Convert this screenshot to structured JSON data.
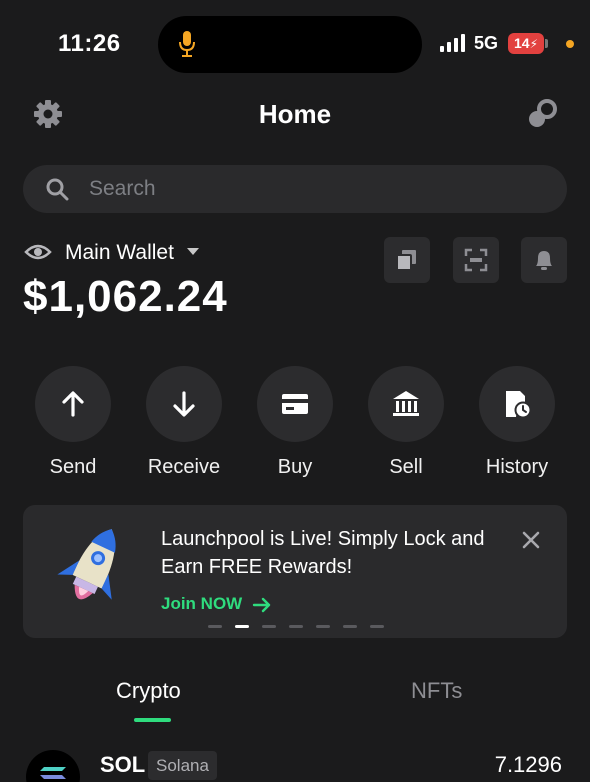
{
  "status_bar": {
    "time": "11:26",
    "network": "5G",
    "battery": "14"
  },
  "header": {
    "title": "Home",
    "left_icon": "gear-icon",
    "right_icon": "link-icon"
  },
  "search": {
    "placeholder": "Search"
  },
  "wallet": {
    "name": "Main Wallet",
    "balance": "$1,062.24",
    "quick_buttons": [
      "copy-icon",
      "scan-icon",
      "bell-icon"
    ]
  },
  "actions": [
    {
      "label": "Send",
      "icon": "arrow-up-icon"
    },
    {
      "label": "Receive",
      "icon": "arrow-down-icon"
    },
    {
      "label": "Buy",
      "icon": "card-icon"
    },
    {
      "label": "Sell",
      "icon": "bank-icon"
    },
    {
      "label": "History",
      "icon": "history-icon"
    }
  ],
  "banner": {
    "text": "Launchpool is Live! Simply Lock and Earn FREE Rewards!",
    "cta": "Join NOW",
    "slide_count": 7,
    "active_slide": 2
  },
  "tabs": [
    {
      "label": "Crypto",
      "active": true
    },
    {
      "label": "NFTs",
      "active": false
    }
  ],
  "tokens": [
    {
      "symbol": "SOL",
      "chain": "Solana",
      "amount": "7.1296"
    }
  ],
  "colors": {
    "background": "#1b1b1c",
    "surface": "#2a2a2c",
    "accent": "#2fdc7e"
  }
}
